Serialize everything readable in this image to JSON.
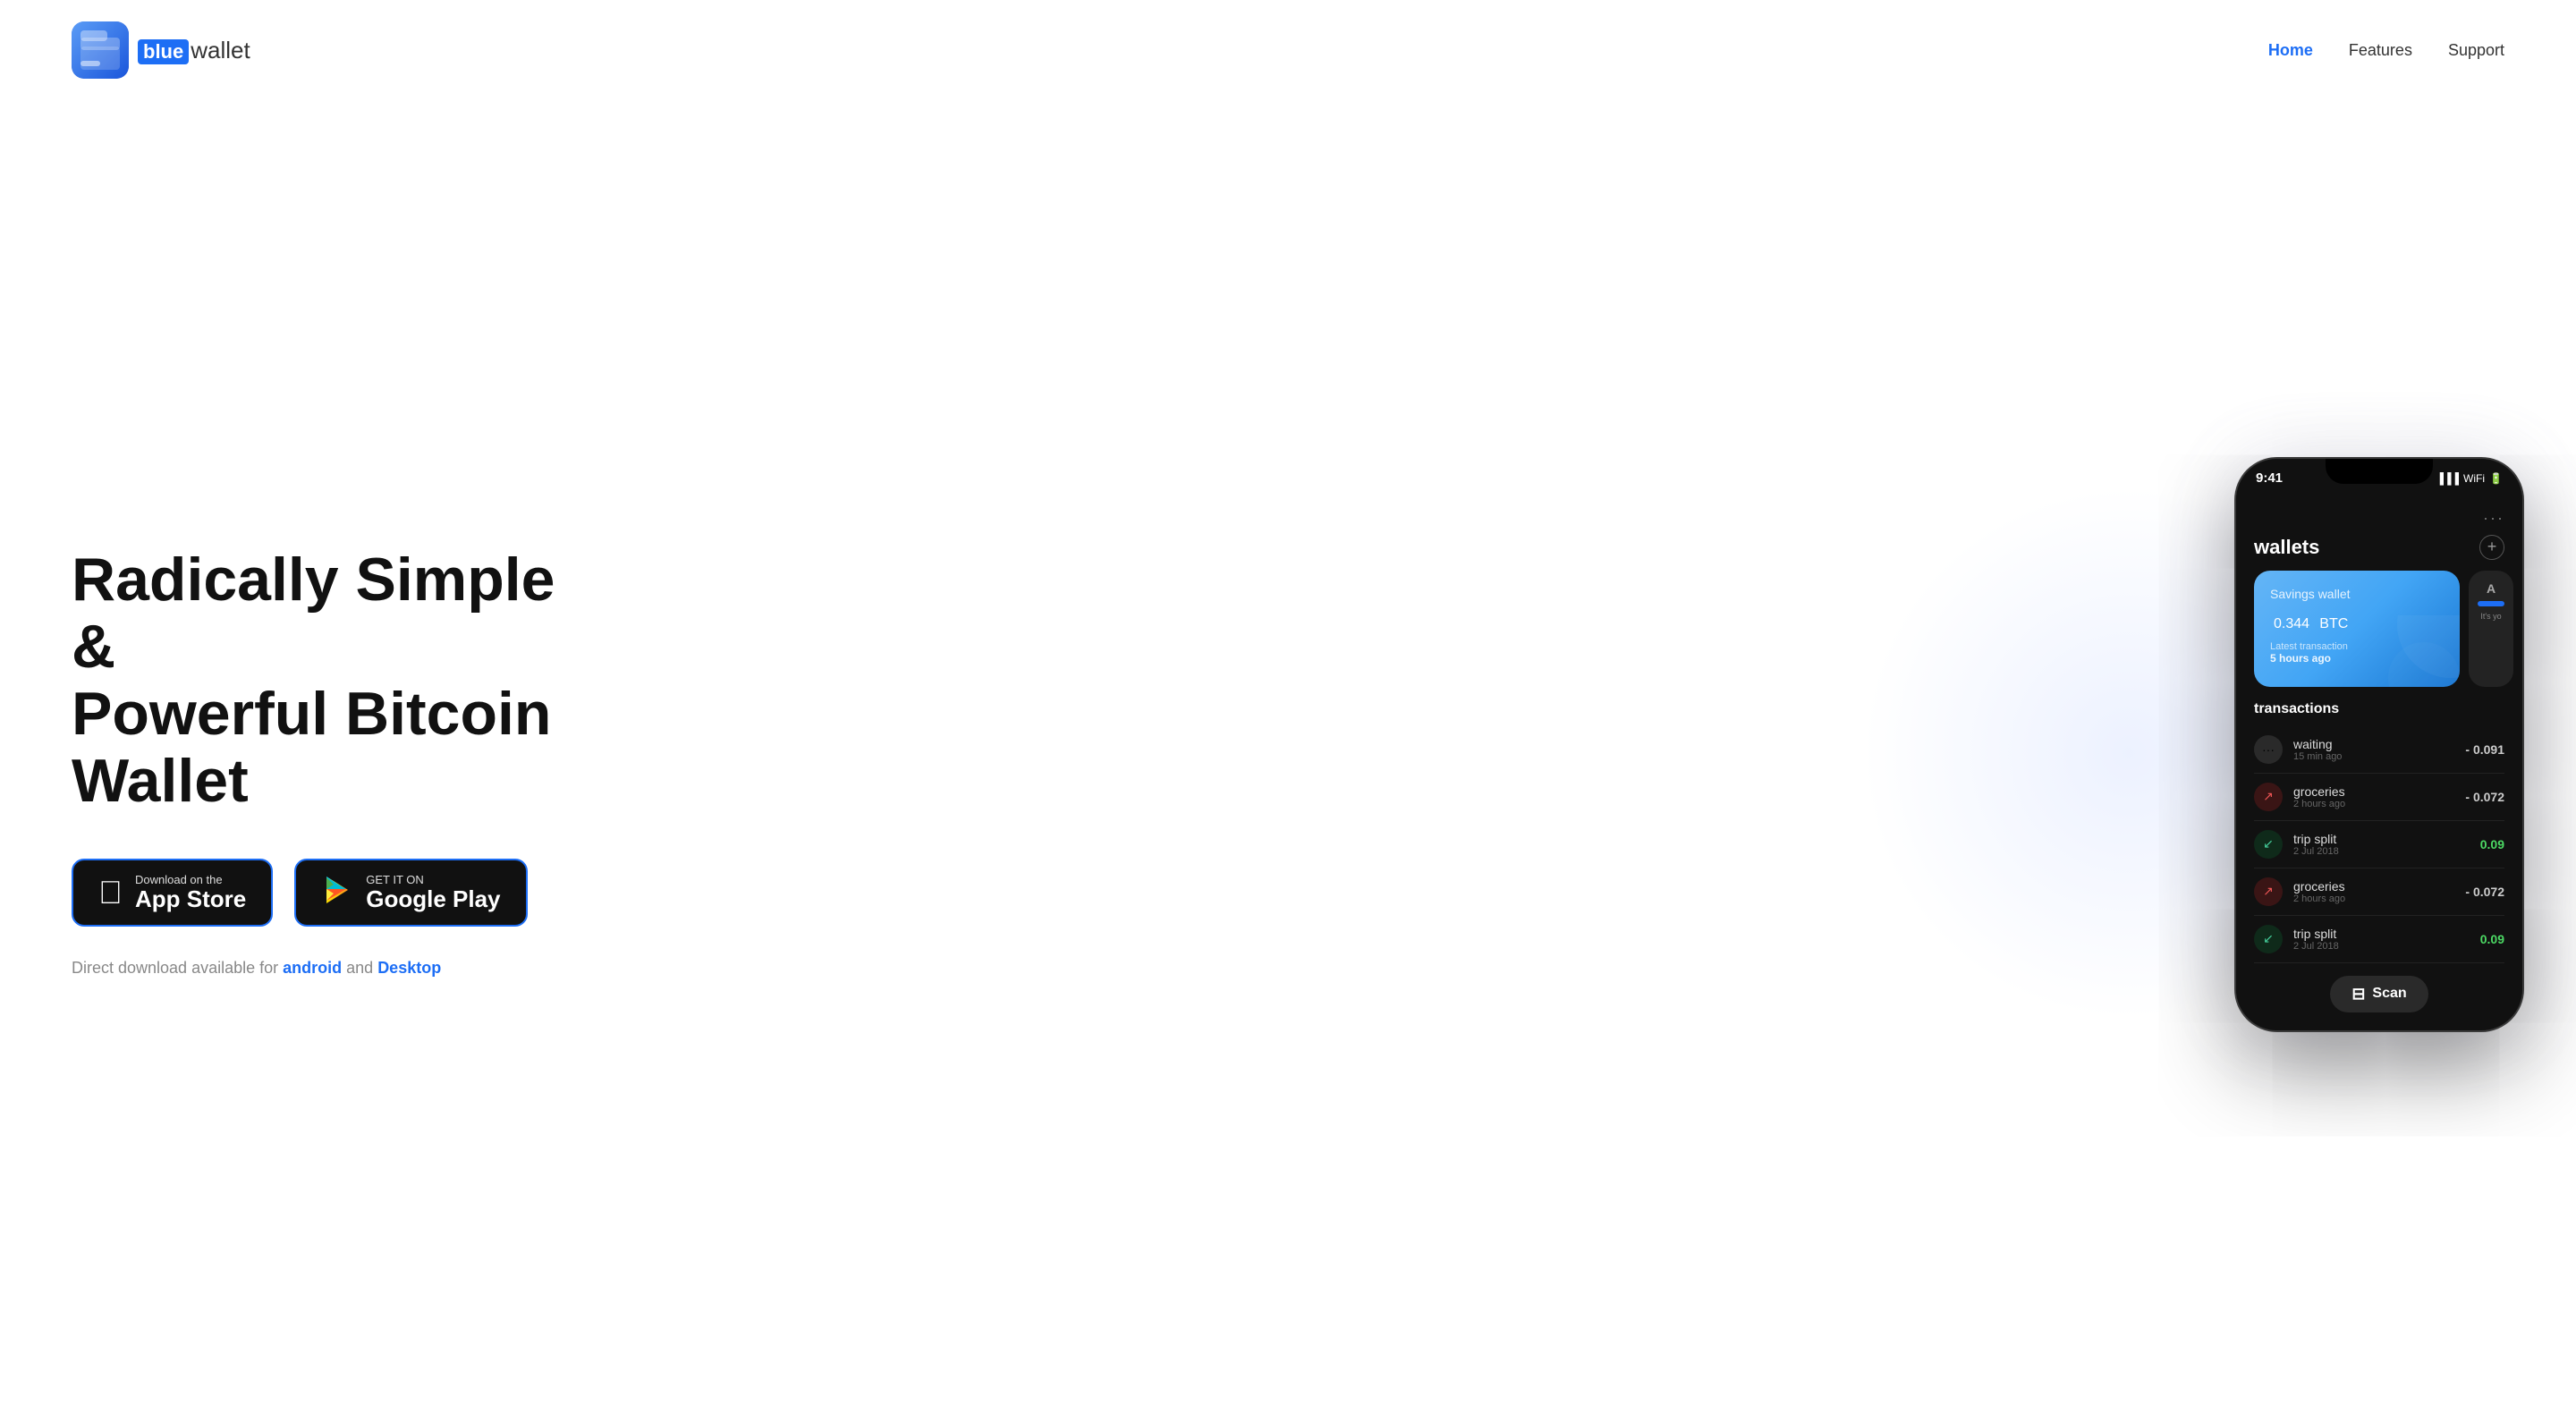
{
  "nav": {
    "logo_blue": "blue",
    "logo_wallet": "wallet",
    "links": [
      {
        "label": "Home",
        "active": true
      },
      {
        "label": "Features",
        "active": false
      },
      {
        "label": "Support",
        "active": false
      }
    ]
  },
  "hero": {
    "title_line1": "Radically Simple &",
    "title_line2": "Powerful Bitcoin Wallet",
    "app_store_sub": "Download on the",
    "app_store_main": "App Store",
    "google_play_sub": "GET IT ON",
    "google_play_main": "Google Play",
    "download_prefix": "Direct download available for ",
    "download_android": "android",
    "download_and": " and ",
    "download_desktop": "Desktop"
  },
  "phone": {
    "time": "9:41",
    "dots_menu": "···",
    "wallets_title": "wallets",
    "add_btn": "+",
    "wallet_card_name": "Savings wallet",
    "wallet_card_amount": "0.344",
    "wallet_card_unit": "BTC",
    "wallet_card_label": "Latest transaction",
    "wallet_card_time": "5 hours ago",
    "wallet_card2_label": "A",
    "wallet_card2_sub": "It's yo",
    "transactions_title": "transactions",
    "transactions": [
      {
        "name": "waiting",
        "time": "15 min ago",
        "amount": "- 0.091",
        "type": "pending"
      },
      {
        "name": "groceries",
        "time": "2 hours ago",
        "amount": "- 0.072",
        "type": "out"
      },
      {
        "name": "trip split",
        "time": "2 Jul 2018",
        "amount": "0.09",
        "type": "in"
      },
      {
        "name": "groceries",
        "time": "2 hours ago",
        "amount": "- 0.072",
        "type": "out"
      },
      {
        "name": "trip split",
        "time": "2 Jul 2018",
        "amount": "0.09",
        "type": "in"
      }
    ],
    "scan_label": "Scan"
  },
  "colors": {
    "accent_blue": "#1d6ef5",
    "positive": "#4cd964",
    "negative": "#cccccc"
  }
}
